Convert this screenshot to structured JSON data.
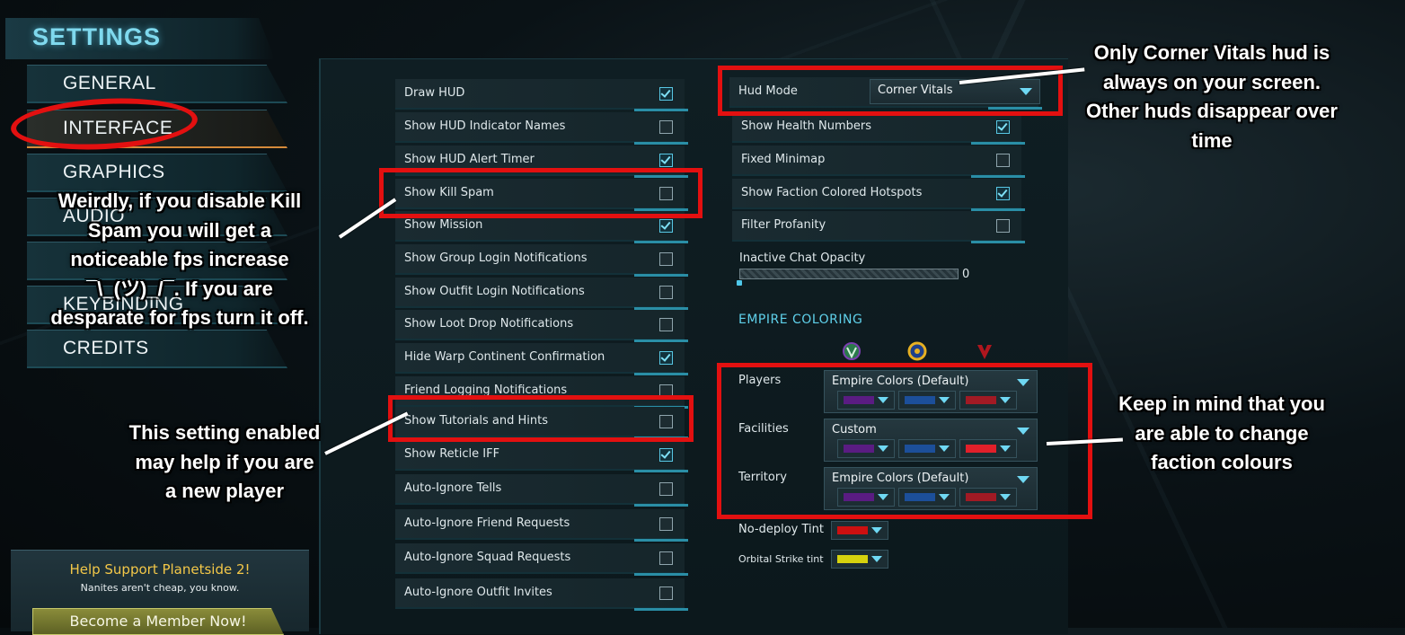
{
  "nav": {
    "title": "SETTINGS",
    "items": [
      {
        "label": "GENERAL"
      },
      {
        "label": "INTERFACE"
      },
      {
        "label": "GRAPHICS"
      },
      {
        "label": "AUDIO"
      },
      {
        "label": ""
      },
      {
        "label": "KEYBINDING"
      },
      {
        "label": "CREDITS"
      }
    ],
    "active": "INTERFACE"
  },
  "support": {
    "title": "Help Support Planetside 2!",
    "subtitle": "Nanites aren't cheap, you know.",
    "button": "Become a Member Now!"
  },
  "left_options": [
    {
      "label": "Draw HUD",
      "checked": true
    },
    {
      "label": "Show HUD Indicator Names",
      "checked": false
    },
    {
      "label": "Show HUD Alert Timer",
      "checked": true
    },
    {
      "label": "Show Kill Spam",
      "checked": false
    },
    {
      "label": "Show Mission",
      "checked": true
    },
    {
      "label": "Show Group  Login Notifications",
      "checked": false
    },
    {
      "label": "Show Outfit Login Notifications",
      "checked": false
    },
    {
      "label": "Show Loot Drop Notifications",
      "checked": false
    },
    {
      "label": "Hide Warp Continent Confirmation",
      "checked": true
    },
    {
      "label": "Friend Logging Notifications",
      "checked": false
    },
    {
      "label": "Show Tutorials and Hints",
      "checked": false
    },
    {
      "label": "Show Reticle IFF",
      "checked": true
    },
    {
      "label": "Auto-Ignore Tells",
      "checked": false
    },
    {
      "label": "Auto-Ignore Friend Requests",
      "checked": false
    },
    {
      "label": "Auto-Ignore Squad Requests",
      "checked": false
    },
    {
      "label": "Auto-Ignore Outfit Invites",
      "checked": false
    }
  ],
  "right_options": {
    "hud_mode": {
      "label": "Hud Mode",
      "value": "Corner Vitals"
    },
    "toggles": [
      {
        "label": "Show Health Numbers",
        "checked": true
      },
      {
        "label": "Fixed Minimap",
        "checked": false
      },
      {
        "label": "Show Faction Colored Hotspots",
        "checked": true
      },
      {
        "label": "Filter Profanity",
        "checked": false
      }
    ],
    "chat_opacity": {
      "label": "Inactive Chat Opacity",
      "value": "0",
      "fraction": 0.0
    }
  },
  "empire_coloring": {
    "title": "EMPIRE COLORING",
    "factions": [
      "vanu-icon",
      "nc-icon",
      "tr-icon"
    ],
    "rows": [
      {
        "label": "Players",
        "value": "Empire Colors (Default)",
        "swatches": [
          "#5a1c82",
          "#1c4f9a",
          "#a11a24"
        ]
      },
      {
        "label": "Facilities",
        "value": "Custom",
        "swatches": [
          "#5a1c82",
          "#1c4f9a",
          "#e2202a"
        ]
      },
      {
        "label": "Territory",
        "value": "Empire Colors (Default)",
        "swatches": [
          "#5a1c82",
          "#1c4f9a",
          "#a11a24"
        ]
      }
    ],
    "no_deploy": {
      "label": "No-deploy Tint",
      "color": "#cc1010"
    },
    "orbital": {
      "label": "Orbital Strike tint",
      "color": "#d6d20e"
    }
  },
  "annotations": {
    "hud": [
      "Only Corner Vitals hud is",
      "always on your screen.",
      "Other huds disappear over",
      "time"
    ],
    "killspam": [
      "Weirdly, if you disable Kill",
      "Spam you will get a",
      "noticeable fps increase",
      "¯\\_(ツ)_/¯. If you are",
      "desparate for fps turn it off."
    ],
    "tutorials": [
      "This setting enabled",
      "may help if you are",
      "a new player"
    ],
    "colors": [
      "Keep in mind that you",
      "are able to change",
      "faction colours"
    ]
  },
  "colors": {
    "accent": "#5fd0ea",
    "highlight": "#e31010",
    "gold": "#f3c748"
  }
}
